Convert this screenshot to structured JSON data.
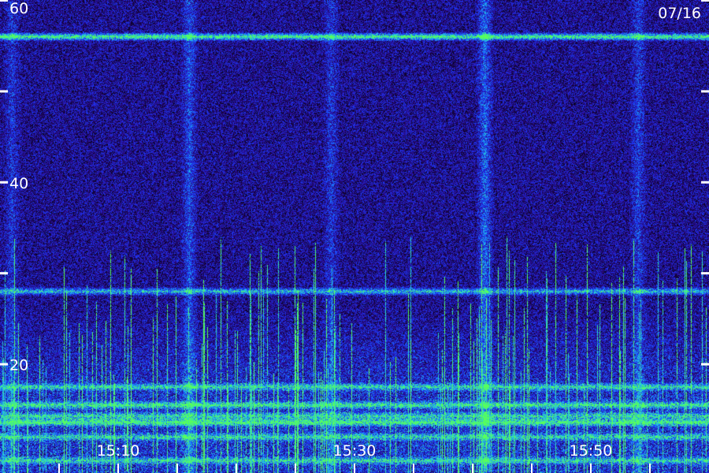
{
  "chart_data": {
    "type": "heatmap",
    "date": "07/16",
    "y_ticks": [
      {
        "value": 60,
        "label": "60"
      },
      {
        "value": 50,
        "label": ""
      },
      {
        "value": 40,
        "label": "40"
      },
      {
        "value": 30,
        "label": ""
      },
      {
        "value": 20,
        "label": "20"
      }
    ],
    "x_labels": [
      {
        "value": "15:10",
        "label": "15:10"
      },
      {
        "value": "15:30",
        "label": "15:30"
      },
      {
        "value": "15:50",
        "label": "15:50"
      }
    ],
    "x_range": [
      "15:00",
      "16:00"
    ],
    "y_range": [
      8,
      60
    ],
    "horizontal_bands": [
      {
        "level": 56,
        "intensity": 0.85
      },
      {
        "level": 28,
        "intensity": 0.6
      },
      {
        "level": 17.5,
        "intensity": 0.55
      },
      {
        "level": 15.5,
        "intensity": 0.6
      },
      {
        "level": 14.3,
        "intensity": 0.5
      },
      {
        "level": 13.6,
        "intensity": 0.7
      },
      {
        "level": 12,
        "intensity": 0.5
      },
      {
        "level": 9.4,
        "intensity": 0.5
      }
    ],
    "vertical_bands": [
      {
        "time": "15:01",
        "intensity": 0.35
      },
      {
        "time": "15:16",
        "intensity": 0.5
      },
      {
        "time": "15:28",
        "intensity": 0.35
      },
      {
        "time": "15:41",
        "intensity": 0.6
      },
      {
        "time": "15:54",
        "intensity": 0.4
      }
    ],
    "colors": {
      "background": "#000000",
      "low": "#2b0a8c",
      "mid": "#1a3cff",
      "high": "#21c8e6",
      "peak": "#58ff5a",
      "text": "#ffffff"
    }
  }
}
